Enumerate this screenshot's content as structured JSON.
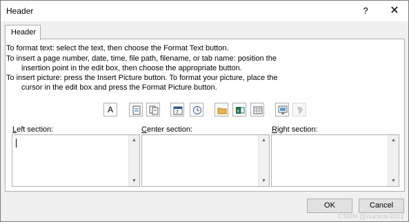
{
  "window": {
    "title": "Header",
    "help": "?",
    "close": "✕"
  },
  "tabs": [
    {
      "label": "Header"
    }
  ],
  "instructions": {
    "line1": "To format text:  select the text, then choose the Format Text button.",
    "line2": "To insert a page number, date, time, file path, filename, or tab name:  position the",
    "line3": "insertion point in the edit box, then choose the appropriate button.",
    "line4": "To insert picture: press the Insert Picture button.  To format your picture, place the",
    "line5": "cursor in the edit box and press the Format Picture button."
  },
  "toolbar": {
    "format_text_label": "A",
    "icons": [
      "format-text-icon",
      "page-number-icon",
      "number-of-pages-icon",
      "date-icon",
      "time-icon",
      "file-path-icon",
      "filename-icon",
      "sheet-name-icon",
      "insert-picture-icon",
      "format-picture-icon"
    ]
  },
  "sections": {
    "left": {
      "label_ul": "L",
      "label_rest": "eft section:",
      "value": ""
    },
    "center": {
      "label_ul": "C",
      "label_rest": "enter section:",
      "value": ""
    },
    "right": {
      "label_ul": "R",
      "label_rest": "ight section:",
      "value": ""
    }
  },
  "buttons": {
    "ok": "OK",
    "cancel": "Cancel"
  },
  "watermark": "CSDN @nuclear2011"
}
